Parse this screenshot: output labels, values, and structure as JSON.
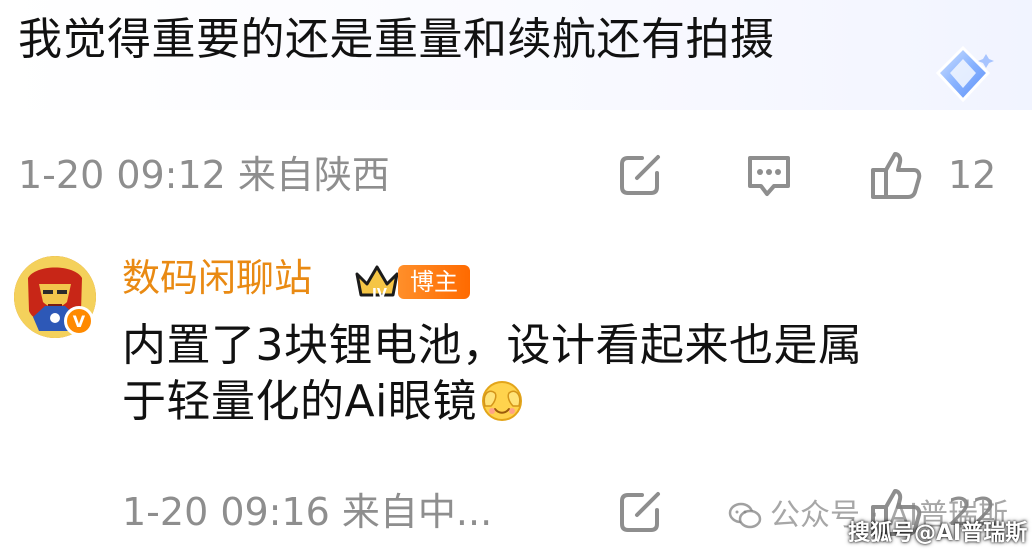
{
  "top_comment": {
    "text": "我觉得重要的还是重量和续航还有拍摄"
  },
  "first_meta": {
    "time_location": "1-20 09:12  来自陕西",
    "like_count": "12"
  },
  "second_comment": {
    "username": "数码闲聊站",
    "tag": "博主",
    "text_line1": "内置了3块锂电池，设计看起来也是属",
    "text_line2": "于轻量化的Ai眼镜",
    "time_location": "1-20 09:16  来自中...",
    "like_count": "22"
  },
  "watermarks": {
    "wechat": "公众号 · AI普瑞斯",
    "sohu": "搜狐号@AI普瑞斯"
  },
  "icons": [
    "gem-icon",
    "share-icon",
    "comment-icon",
    "like-icon",
    "crown-icon",
    "verify-icon",
    "emoji-icon",
    "wechat-icon"
  ],
  "colors": {
    "username": "#e98a13",
    "meta": "#8e8e8e",
    "tag": "#ff7a10"
  }
}
